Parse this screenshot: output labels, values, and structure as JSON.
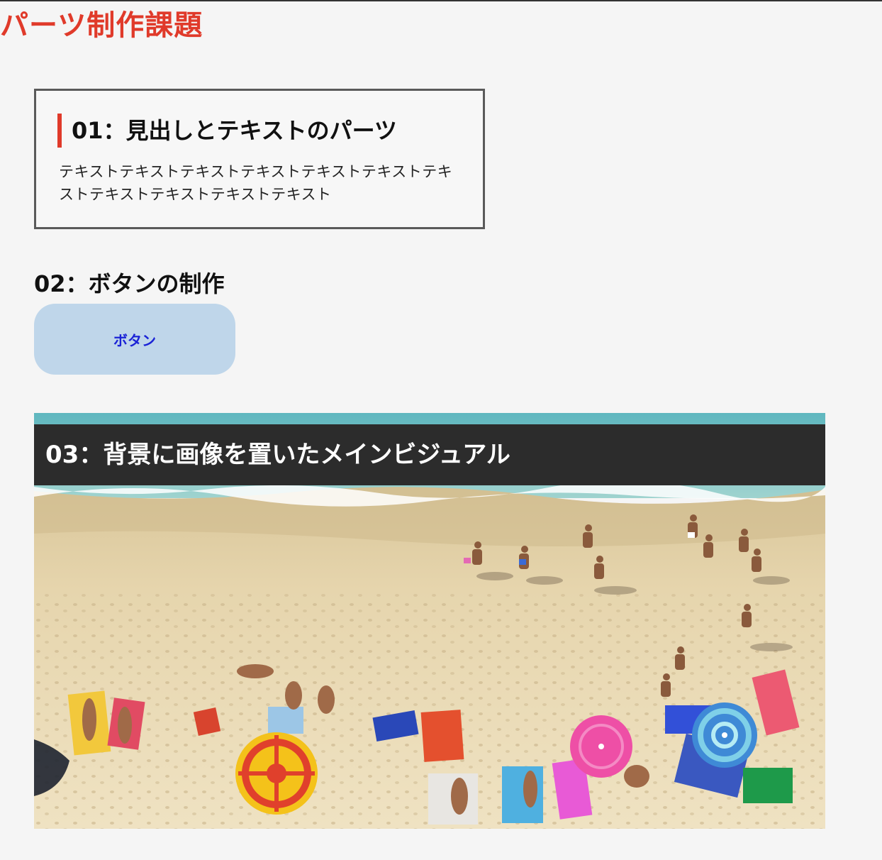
{
  "page": {
    "title": "パーツ制作課題"
  },
  "section01": {
    "heading": "01：見出しとテキストのパーツ",
    "text": "テキストテキストテキストテキストテキストテキストテキストテキストテキストテキストテキスト"
  },
  "section02": {
    "heading": "02：ボタンの制作",
    "button_label": "ボタン"
  },
  "section03": {
    "heading": "03：背景に画像を置いたメインビジュアル",
    "background_image": "beach-aerial-photo"
  },
  "colors": {
    "accent_red": "#e03a2a",
    "button_bg": "#bfd6ea",
    "button_text": "#1a22d6",
    "band_bg": "#2c2c2c"
  }
}
